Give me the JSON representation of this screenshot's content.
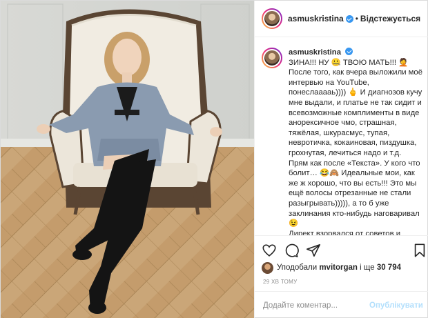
{
  "post": {
    "username": "asmuskristina",
    "separator": "•",
    "follow_status": "Відстежується",
    "photo_description_icon": "photo-of-woman-in-armchair"
  },
  "caption": {
    "username": "asmuskristina",
    "text": "ЗИНА!!! НУ 🤐 ТВОЮ МАТЬ!!! 🤦\nПосле того, как вчера выложили моё интервью на YouTube, понеслааааь)))) 🖕 И диагнозов кучу мне выдали, и платье не так сидит и всевозможные комплименты в виде анорексичное чмо, страшная, тяжёлая, шкурасмус, тупая, невротичка, кокаиновая, пиздушка, грохнутая, лечиться надо и т.д. Прям как после «Текста». У кого что болит… 😂🙈 Идеальные мои, как же ж хорошо, что вы есть!!! Это мы ещё волосы отрезанные не стали разыгрывать))))), а то б уже заклинания кто-нибудь наговаривал 😉\nДирект взорвался от советов и"
  },
  "actions": {
    "like_icon": "heart-icon",
    "comment_icon": "comment-icon",
    "share_icon": "share-icon",
    "save_icon": "bookmark-icon"
  },
  "likes": {
    "prefix": "Уподобали",
    "user": "mvitorgan",
    "suffix": "і ще",
    "count": "30 794"
  },
  "timestamp": "29 хв тому",
  "comment": {
    "placeholder": "Додайте коментар...",
    "post_label": "Опублікувати",
    "post_color": "#b2dffc"
  },
  "colors": {
    "verified": "#3897f0",
    "border": "#dbdbdb",
    "muted": "#8e8e8e"
  }
}
